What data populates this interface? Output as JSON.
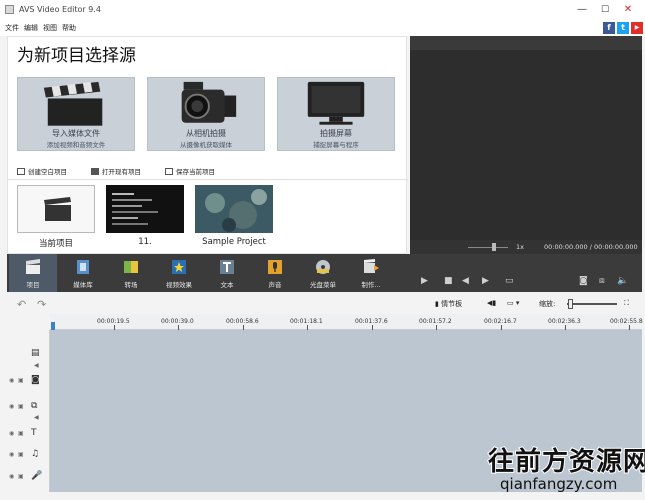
{
  "window": {
    "title": "AVS Video Editor 9.4",
    "controls": [
      "—",
      "☐",
      "✕"
    ]
  },
  "menu": [
    "文件",
    "编辑",
    "视图",
    "帮助"
  ],
  "social": [
    "f",
    "t",
    "▶"
  ],
  "start_panel": {
    "title": "为新项目选择源",
    "tiles": [
      {
        "label": "导入媒体文件",
        "sub": "添加视频和音频文件",
        "icon": "clapperboard-icon"
      },
      {
        "label": "从相机拍摄",
        "sub": "从摄像机获取媒体",
        "icon": "camcorder-icon"
      },
      {
        "label": "拍摄屏幕",
        "sub": "捕捉屏幕与程序",
        "icon": "monitor-icon"
      }
    ],
    "actions": [
      "创建空白项目",
      "打开现有项目",
      "保存当前项目"
    ],
    "recent": [
      "当前项目",
      "11.",
      "Sample Project"
    ]
  },
  "preview": {
    "speed": "1x",
    "timecode": "00:00:00.000 / 00:00:00.000"
  },
  "toolbar": {
    "items": [
      "项目",
      "媒体库",
      "转场",
      "视频效果",
      "文本",
      "声音",
      "光盘菜单",
      "制作..."
    ],
    "selected_index": 0
  },
  "timeline": {
    "storyboard_label": "▮ 情节板",
    "zoom_label": "缩放:",
    "ruler": [
      "00:00:19.5",
      "00:00:39.0",
      "00:00:58.6",
      "00:01:18.1",
      "00:01:37.6",
      "00:01:57.2",
      "00:02:16.7",
      "00:02:36.3",
      "00:02:55.8"
    ]
  },
  "watermark": {
    "main": "往前方资源网",
    "sub": "qianfangzy.com"
  }
}
